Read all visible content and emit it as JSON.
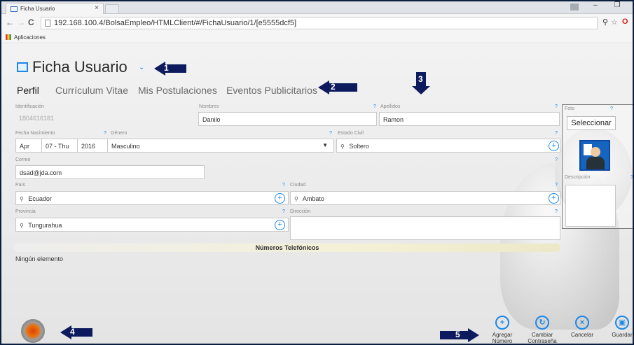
{
  "browser": {
    "tab_title": "Ficha Usuario",
    "tab_close": "×",
    "url": "192.168.100.4/BolsaEmpleo/HTMLClient/#/FichaUsuario/1/[e5555dcf5]",
    "bookmarks_apps": "Aplicaciones",
    "win_min": "–",
    "win_restore": "❐",
    "nav_back": "←",
    "nav_forward": "→",
    "nav_reload": "C",
    "ext_key": "⚲",
    "ext_star": "☆",
    "ext_opera": "O"
  },
  "page": {
    "title": "Ficha Usuario",
    "chevron": "⌄",
    "tabs": [
      "Perfil",
      "Currículum Vitae",
      "Mis Postulaciones",
      "Eventos Publicitarios"
    ]
  },
  "form": {
    "identificacion_label": "Identificación",
    "identificacion_value": "1804616181",
    "nombres_label": "Nombres",
    "nombres_value": "Danilo",
    "apellidos_label": "Apellidos",
    "apellidos_value": "Ramon",
    "fecha_label": "Fecha Nacimiento",
    "fecha_month": "Apr",
    "fecha_day": "07 - Thu",
    "fecha_year": "2016",
    "genero_label": "Género",
    "genero_value": "Masculino",
    "estado_label": "Estado Civil",
    "estado_value": "Soltero",
    "correo_label": "Correo",
    "correo_value": "dsad@jda.com",
    "pais_label": "País",
    "pais_value": "Ecuador",
    "ciudad_label": "Ciudad",
    "ciudad_value": "Ambato",
    "provincia_label": "Provincia",
    "provincia_value": "Tungurahua",
    "direccion_label": "Dirección",
    "help": "?",
    "search_glyph": "⚲",
    "caret": "▼",
    "plus": "+"
  },
  "photo": {
    "label": "Foto",
    "button": "Seleccionar",
    "desc_label": "Descripción"
  },
  "phones": {
    "header": "Números Telefónicos",
    "empty": "Ningún elemento"
  },
  "actions": {
    "add_glyph": "+",
    "add_line1": "Agregar",
    "add_line2": "Número",
    "pass_glyph": "↻",
    "pass_line1": "Cambiar",
    "pass_line2": "Contraseña",
    "cancel_glyph": "×",
    "cancel": "Cancelar",
    "save_glyph": "▣",
    "save": "Guardar"
  },
  "annotations": [
    "1",
    "2",
    "3",
    "4",
    "5"
  ],
  "colors": {
    "accent": "#1e88e5",
    "arrow": "#0d1b5e",
    "frame": "#0b1e3f"
  }
}
